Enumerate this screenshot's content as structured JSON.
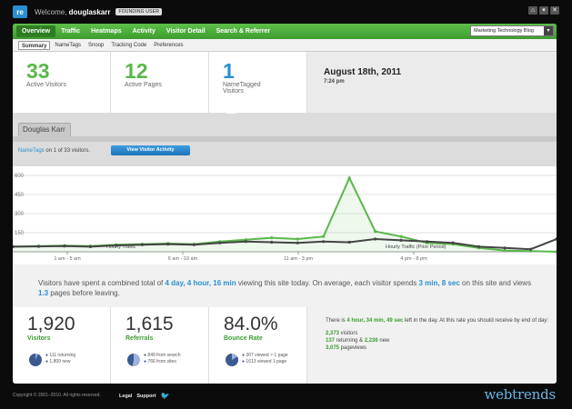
{
  "topbar": {
    "logo_text": "re",
    "welcome_prefix": "Welcome,",
    "username": "douglaskarr",
    "badge": "FOUNDING USER",
    "icons": [
      "home-icon",
      "dropdown-icon",
      "close-icon"
    ],
    "icon_glyphs": [
      "⌂",
      "▾",
      "✕"
    ]
  },
  "nav": {
    "items": [
      "Overview",
      "Traffic",
      "Heatmaps",
      "Activity",
      "Visitor Detail",
      "Search & Referrer"
    ],
    "active_index": 0,
    "site_selector": "Marketing Technology Blog"
  },
  "subnav": {
    "items": [
      "Summary",
      "NameTags",
      "Snoop",
      "Tracking Code",
      "Preferences"
    ],
    "active_index": 0
  },
  "stats": {
    "active_visitors": {
      "value": "33",
      "label": "Active Visitors"
    },
    "active_pages": {
      "value": "12",
      "label": "Active Pages"
    },
    "nametagged": {
      "value": "1",
      "label_1": "NameTagged",
      "label_2": "Visitors"
    },
    "date": "August 18th, 2011",
    "time": "7:24 pm"
  },
  "visitor": {
    "tab_label": "Douglas Karr",
    "line_link": "NameTags",
    "line_text": " on 1 of 33 visitors.",
    "button_label": "View Visitor Activity"
  },
  "chart_data": {
    "type": "line",
    "x_ticks": [
      "1 am - 5 am",
      "6 am - 10 am",
      "11 am - 3 pm",
      "4 pm - 8 pm"
    ],
    "y_ticks": [
      "600",
      "450",
      "300",
      "150"
    ],
    "ylim": [
      0,
      600
    ],
    "annotations": [
      "Hourly Traffic",
      "Hourly Traffic (Prior Period)"
    ],
    "series": [
      {
        "name": "Hourly Traffic",
        "color": "#5ab84a",
        "values": [
          40,
          45,
          48,
          45,
          55,
          60,
          65,
          60,
          80,
          95,
          110,
          100,
          120,
          580,
          160,
          120,
          70,
          60,
          30,
          10,
          5,
          0
        ]
      },
      {
        "name": "Hourly Traffic (Prior Period)",
        "color": "#444444",
        "values": [
          40,
          42,
          45,
          40,
          50,
          55,
          60,
          55,
          70,
          80,
          75,
          70,
          80,
          75,
          100,
          90,
          80,
          70,
          40,
          30,
          20,
          100
        ]
      }
    ]
  },
  "summary": {
    "p1": "Visitors have spent a combined total of ",
    "h1": "4 day, 4 hour, 16 min",
    "p2": " viewing this site today. On average, each visitor spends ",
    "h2": "3 min, 8 sec",
    "p3": " on this site and views ",
    "h3": "1.3",
    "p4": " pages before leaving."
  },
  "bottom": {
    "visitors": {
      "value": "1,920",
      "label": "Visitors",
      "legend_1": "111 returning",
      "legend_2": "1,809 new",
      "fraction": 0.06
    },
    "referrals": {
      "value": "1,615",
      "label": "Referrals",
      "legend_1": "849 from search",
      "legend_2": "766 from sites",
      "fraction": 0.53
    },
    "bounce": {
      "value": "84.0%",
      "label": "Bounce Rate",
      "legend_1": "307 viewed > 1 page",
      "legend_2": "1613 viewed 1 page",
      "fraction": 0.16
    },
    "forecast": {
      "pre": "There is ",
      "hl": "4 hour, 34 min, 49 sec",
      "post": " left in the day. At this rate you should receive by end of day:",
      "line1_hl": "2,373",
      "line1": " visitors",
      "line2_hl": "137",
      "line2_a": " returning & ",
      "line2_hl2": "2,236",
      "line2_b": " new",
      "line3_hl": "3,075",
      "line3": " pageviews"
    }
  },
  "footer": {
    "copyright": "Copyright © 2001–2010. All rights reserved.",
    "legal": "Legal",
    "support": "Support",
    "bird": "🐦",
    "brand": "webtrends"
  },
  "colors": {
    "accent_green": "#5ab84a",
    "accent_blue": "#2a8fd0",
    "pie_dark": "#3b5a92",
    "pie_light": "#9db3d8"
  }
}
